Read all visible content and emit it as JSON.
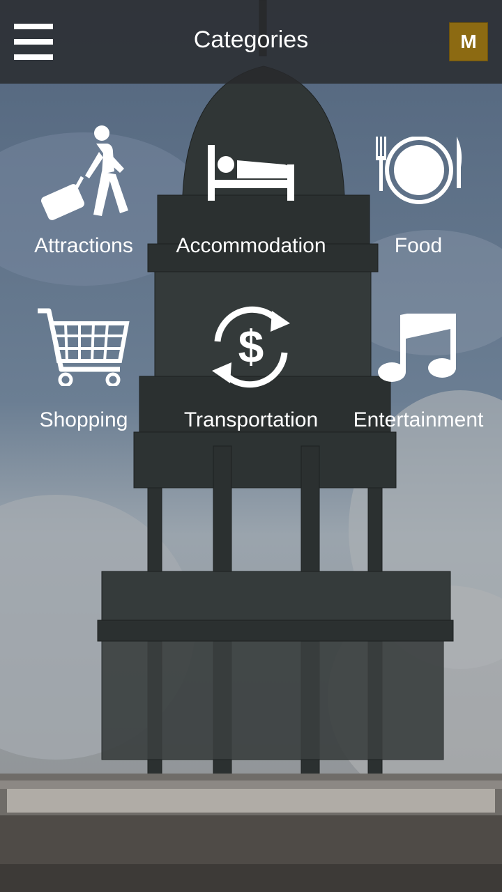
{
  "header": {
    "title": "Categories",
    "menu_icon": "hamburger-menu-icon",
    "profile_label": "M",
    "profile_color": "#8c6a12"
  },
  "categories": [
    {
      "label": "Attractions",
      "icon": "traveler-luggage-icon"
    },
    {
      "label": "Accommodation",
      "icon": "bed-icon"
    },
    {
      "label": "Food",
      "icon": "plate-fork-knife-icon"
    },
    {
      "label": "Shopping",
      "icon": "shopping-cart-icon"
    },
    {
      "label": "Transportation",
      "icon": "currency-exchange-icon"
    },
    {
      "label": "Entertainment",
      "icon": "music-note-icon"
    }
  ]
}
